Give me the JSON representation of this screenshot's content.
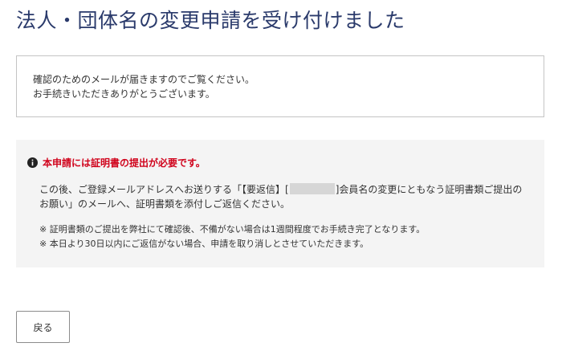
{
  "page": {
    "title": "法人・団体名の変更申請を受け付けました"
  },
  "confirmation": {
    "line1": "確認のためのメールが届きますのでご覧ください。",
    "line2": "お手続きいただきありがとうございます。"
  },
  "notice": {
    "icon": "info-circle-icon",
    "heading": "本申請には証明書の提出が必要です。",
    "body_line1_before": "この後、ご登録メールアドレスへお送りする「【要返信】[",
    "body_line1_after": "]会員名の変更にともなう証明書類ご提出の",
    "body_line2": "お願い」のメールへ、証明書類を添付しご返信ください。",
    "note1": "※ 証明書類のご提出を弊社にて確認後、不備がない場合は1週間程度でお手続き完了となります。",
    "note2": "※ 本日より30日以内にご返信がない場合、申請を取り消しとさせていただきます。"
  },
  "actions": {
    "back_label": "戻る"
  },
  "colors": {
    "title": "#2a3a6b",
    "notice_heading": "#d0021b",
    "notice_background": "#f4f4f4",
    "border": "#c4c4c4"
  }
}
